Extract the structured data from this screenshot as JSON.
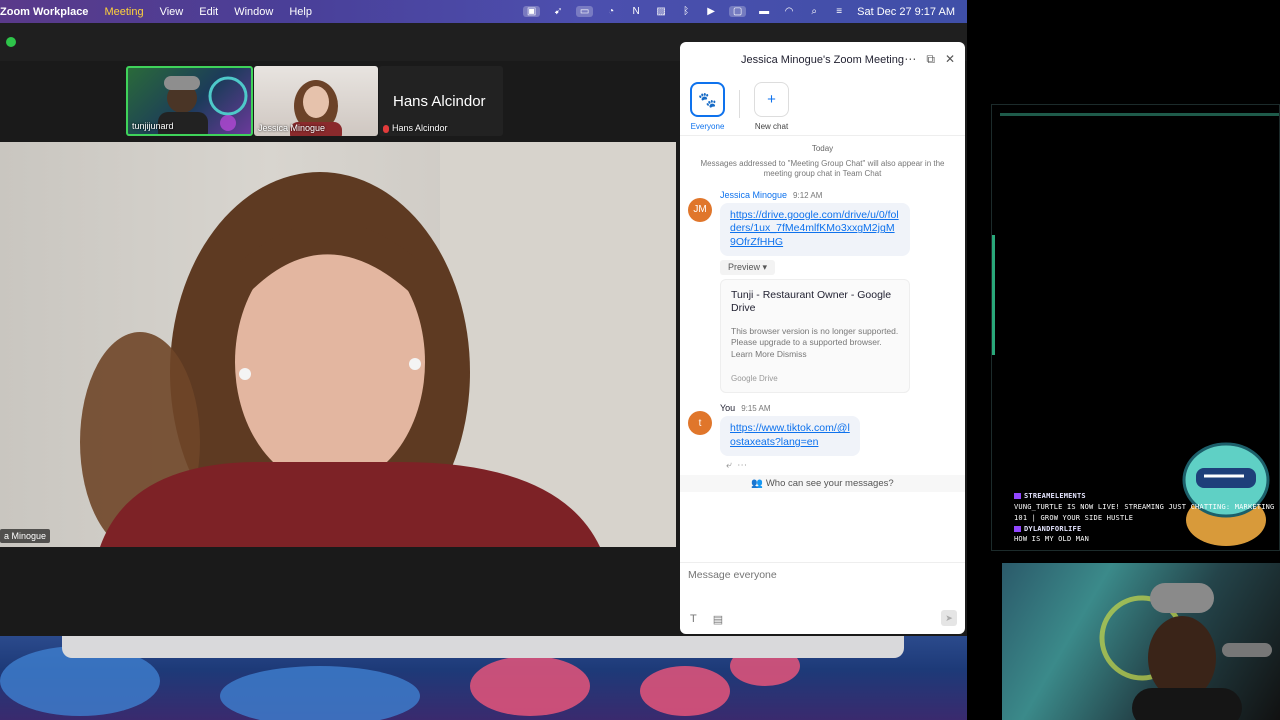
{
  "menubar": {
    "app_name": "Zoom Workplace",
    "items": [
      "Meeting",
      "View",
      "Edit",
      "Window",
      "Help"
    ],
    "clock": "Sat Dec 27  9:17 AM",
    "status_icons": [
      "zoom-status-icon",
      "rocket-icon",
      "screen-share-icon",
      "cast-icon",
      "notion-icon",
      "image-icon",
      "bluetooth-icon",
      "play-icon",
      "screen-mirror-icon",
      "battery-icon",
      "wifi-icon",
      "spotlight-search-icon",
      "control-center-icon"
    ]
  },
  "participants": [
    {
      "name": "tunjijunard"
    },
    {
      "name": "Jessica Minogue"
    },
    {
      "name": "Hans Alcindor",
      "display_name": "Hans Alcindor",
      "muted": true
    }
  ],
  "main_video": {
    "speaker_name": "a Minogue"
  },
  "chat": {
    "title": "Jessica Minogue's Zoom Meeting",
    "tabs": [
      {
        "label": "Everyone",
        "icon": "paw-icon",
        "active": true
      },
      {
        "label": "New chat",
        "icon": "plus-icon",
        "active": false
      }
    ],
    "day_label": "Today",
    "notice": "Messages addressed to \"Meeting Group Chat\" will also appear in the meeting group chat in Team Chat",
    "messages": [
      {
        "sender": "Jessica Minogue",
        "initials": "JM",
        "time": "9:12 AM",
        "link": "https://drive.google.com/drive/u/0/folders/1ux_7fMe4mlfKMo3xxgM2jgM9OfrZfHHG",
        "preview_label": "Preview",
        "card": {
          "title": "Tunji - Restaurant Owner - Google Drive",
          "body": "This browser version is no longer supported. Please upgrade to a supported browser. Learn More Dismiss",
          "source": "Google Drive"
        }
      },
      {
        "sender": "You",
        "initials": "t",
        "time": "9:15 AM",
        "link": "https://www.tiktok.com/@lostaxeats?lang=en"
      }
    ],
    "who_can_see": "Who can see your messages?",
    "composer_placeholder": "Message everyone"
  },
  "stream_overlay": {
    "lines": [
      {
        "user": "STREAMELEMENTS",
        "text": "VUNG_TURTLE IS NOW LIVE! STREAMING JUST CHATTING: MARKETING 101 | GROW YOUR SIDE HUSTLE"
      },
      {
        "user": "DYLANDFORLIFE",
        "text": "HOW IS MY OLD MAN"
      }
    ]
  },
  "colors": {
    "accent": "#0e72ed",
    "active_speaker": "#3fd35a",
    "avatar": "#e0762b",
    "twitch": "#9146ff"
  }
}
